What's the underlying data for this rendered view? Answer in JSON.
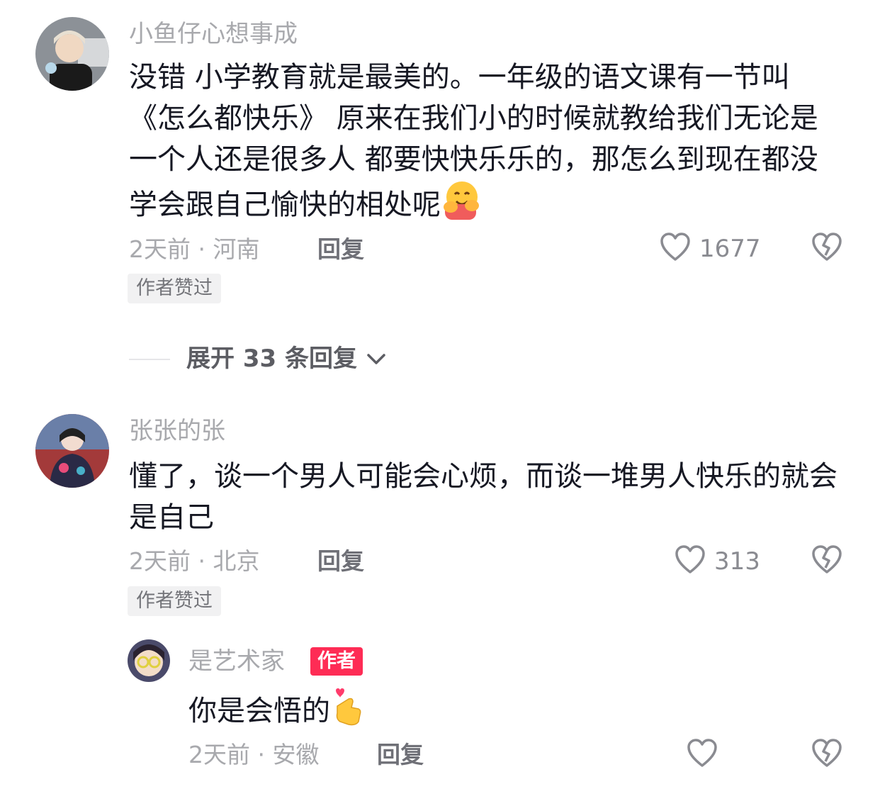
{
  "comments": [
    {
      "username": "小鱼仔心想事成",
      "text": "没错 小学教育就是最美的。一年级的语文课有一节叫《怎么都快乐》 原来在我们小的时候就教给我们无论是一个人还是很多人 都要快快乐乐的，那怎么到现在都没学会跟自己愉快的相处呢",
      "emoji": "hugging-face",
      "time_location": "2天前 · 河南",
      "reply_label": "回复",
      "like_count": "1677",
      "badge": "作者赞过"
    },
    {
      "username": "张张的张",
      "text": "懂了，谈一个男人可能会心烦，而谈一堆男人快乐的就会是自己",
      "time_location": "2天前 · 北京",
      "reply_label": "回复",
      "like_count": "313",
      "badge": "作者赞过"
    }
  ],
  "expand_replies": {
    "label": "展开 33 条回复"
  },
  "author_reply": {
    "username": "是艺术家",
    "author_tag": "作者",
    "text": "你是会悟的",
    "emoji": "finger-heart",
    "time_location": "2天前 · 安徽",
    "reply_label": "回复"
  },
  "colors": {
    "accent": "#fe2c55",
    "text_primary": "#161823",
    "text_secondary": "#a8a9ad"
  }
}
